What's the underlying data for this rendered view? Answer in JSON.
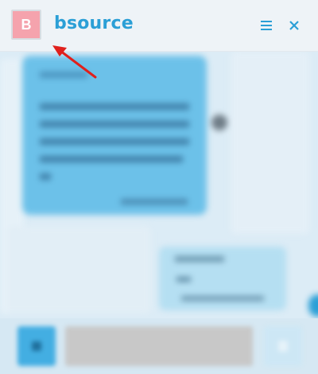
{
  "header": {
    "avatar_initial": "B",
    "title": "bsource",
    "menu_icon": "hamburger-menu-icon",
    "close_icon": "close-icon"
  },
  "colors": {
    "accent": "#2b9fd6",
    "avatar_bg": "#f5a3ad",
    "incoming_bubble": "#6cc1e9",
    "outgoing_bubble": "#b5dff2",
    "annotation_arrow": "#e0201c"
  },
  "footer": {
    "attach_icon": "attach-icon",
    "send_icon": "send-icon"
  }
}
